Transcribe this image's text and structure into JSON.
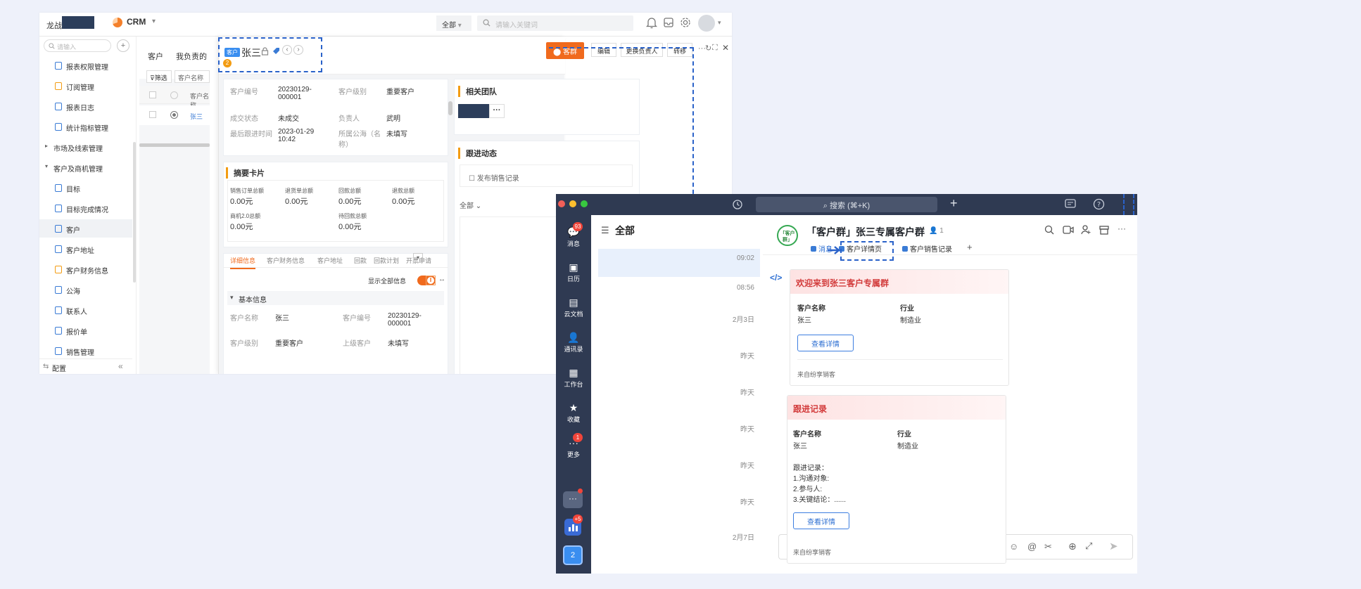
{
  "crm": {
    "brand": "龙战",
    "app_name": "CRM",
    "search_scope": "全部",
    "search_placeholder": "请输入关键词",
    "sidebar": {
      "search_placeholder": "请输入",
      "items": [
        {
          "label": "报表权限管理",
          "type": "item"
        },
        {
          "label": "订阅管理",
          "type": "item"
        },
        {
          "label": "报表日志",
          "type": "item"
        },
        {
          "label": "统计指标管理",
          "type": "item"
        },
        {
          "label": "市场及线索管理",
          "type": "group-collapsed"
        },
        {
          "label": "客户及商机管理",
          "type": "group-expanded"
        },
        {
          "label": "目标",
          "type": "item"
        },
        {
          "label": "目标完成情况",
          "type": "item"
        },
        {
          "label": "客户",
          "type": "item-active"
        },
        {
          "label": "客户地址",
          "type": "item"
        },
        {
          "label": "客户财务信息",
          "type": "item"
        },
        {
          "label": "公海",
          "type": "item"
        },
        {
          "label": "联系人",
          "type": "item"
        },
        {
          "label": "报价单",
          "type": "item"
        },
        {
          "label": "销售管理",
          "type": "item"
        }
      ],
      "footer_label": "配置"
    },
    "list": {
      "tabs": [
        "客户",
        "我负责的"
      ],
      "filter_label": "筛选",
      "column_header": "客户名称",
      "row_name": "张三"
    },
    "detail": {
      "tag": "客户",
      "title": "张三",
      "count_badge": "2",
      "actions": {
        "group_chat": "客群",
        "edit": "编辑",
        "change_owner": "更换负责人",
        "transfer": "转移"
      },
      "fields": [
        {
          "label": "客户编号",
          "value": "20230129-000001"
        },
        {
          "label": "客户级别",
          "value": "重要客户"
        },
        {
          "label": "成交状态",
          "value": "未成交"
        },
        {
          "label": "负责人",
          "value": "武明"
        },
        {
          "label": "最后跟进时间",
          "value": "2023-01-29 10:42"
        },
        {
          "label": "所属公海（名称）",
          "value": "未填写"
        }
      ],
      "summary_title": "摘要卡片",
      "summary": [
        {
          "label": "销售订单总额",
          "value": "0.00元"
        },
        {
          "label": "退货单总额",
          "value": "0.00元"
        },
        {
          "label": "回款总额",
          "value": "0.00元"
        },
        {
          "label": "退款总额",
          "value": "0.00元"
        },
        {
          "label": "商机2.0总额",
          "value": "0.00元"
        },
        {
          "label": "待回款总额",
          "value": "0.00元"
        }
      ],
      "tabs": [
        "详细信息",
        "客户财务信息",
        "客户地址",
        "回款",
        "回款计划",
        "开票申请"
      ],
      "show_all_label": "显示全部信息",
      "basic_info_title": "基本信息",
      "basic_fields": [
        {
          "label": "客户名称",
          "value": "张三"
        },
        {
          "label": "客户编号",
          "value": "20230129-000001"
        },
        {
          "label": "客户级别",
          "value": "重要客户"
        },
        {
          "label": "上级客户",
          "value": "未填写"
        }
      ],
      "team_title": "相关团队",
      "followup_title": "跟进动态",
      "publish_label": "发布销售记录",
      "filter_all": "全部"
    }
  },
  "chat": {
    "search_label": "搜索 (⌘+K)",
    "nav": [
      {
        "label": "消息",
        "badge": "93"
      },
      {
        "label": "日历",
        "badge": ""
      },
      {
        "label": "云文档",
        "badge": ""
      },
      {
        "label": "通讯录",
        "badge": ""
      },
      {
        "label": "工作台",
        "badge": ""
      },
      {
        "label": "收藏",
        "badge": ""
      },
      {
        "label": "更多",
        "badge": "1"
      }
    ],
    "nav_bottom": {
      "plus_badge": "+5",
      "account_label": "2"
    },
    "list_title": "全部",
    "times": [
      "09:02",
      "08:56",
      "2月3日",
      "昨天",
      "昨天",
      "昨天",
      "昨天",
      "昨天",
      "2月7日"
    ],
    "group_avatar_text": "「客户群」",
    "group_name": "「客户群」张三专属客户群",
    "member_count": "1",
    "tabs": [
      "消息",
      "客户详情页",
      "客户销售记录"
    ],
    "card1": {
      "title": "欢迎来到张三客户专属群",
      "fields": [
        {
          "label": "客户名称",
          "value": "张三"
        },
        {
          "label": "行业",
          "value": "制造业"
        }
      ],
      "button": "查看详情",
      "source": "来自纷享销客"
    },
    "card2": {
      "title": "跟进记录",
      "fields": [
        {
          "label": "客户名称",
          "value": "张三"
        },
        {
          "label": "行业",
          "value": "制造业"
        }
      ],
      "record_lines": [
        "跟进记录：",
        "1.沟通对象:",
        "2.参与人:",
        "3.关键结论：......"
      ],
      "button": "查看详情",
      "source": "来自纷享销客"
    }
  },
  "colors": {
    "accent_orange": "#f06a1d",
    "annotation_blue": "#2a62c9",
    "chat_nav_bg": "#2f3a52",
    "card_title_red": "#d23a3a"
  }
}
